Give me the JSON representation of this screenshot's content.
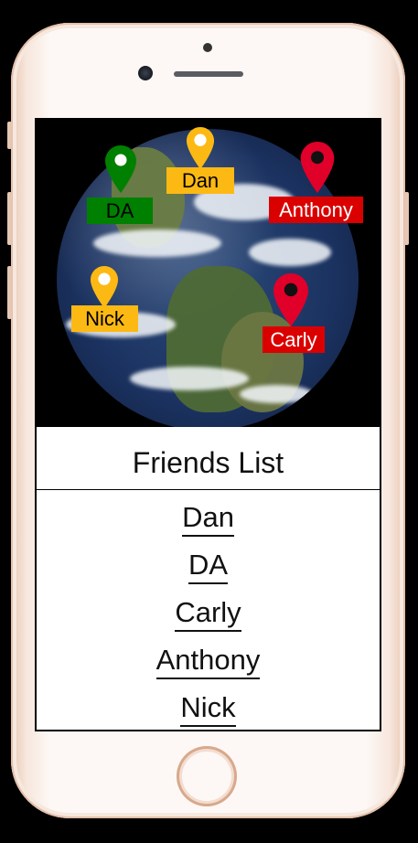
{
  "map": {
    "pins": [
      {
        "label": "DA",
        "color": "#008000",
        "label_bg": "#008000",
        "label_color": "#000000"
      },
      {
        "label": "Dan",
        "color": "#FDB913",
        "label_bg": "#FDB913",
        "label_color": "#000000"
      },
      {
        "label": "Anthony",
        "color": "#E0002A",
        "label_bg": "#DB0000",
        "label_color": "#FFFFFF"
      },
      {
        "label": "Nick",
        "color": "#FDB913",
        "label_bg": "#FDB913",
        "label_color": "#000000"
      },
      {
        "label": "Carly",
        "color": "#E0002A",
        "label_bg": "#DB0000",
        "label_color": "#FFFFFF"
      }
    ]
  },
  "friends": {
    "title": "Friends List",
    "items": [
      "Dan",
      "DA",
      "Carly",
      "Anthony",
      "Nick"
    ]
  },
  "icons": {
    "pin": "map-pin-icon",
    "home": "home-button"
  }
}
